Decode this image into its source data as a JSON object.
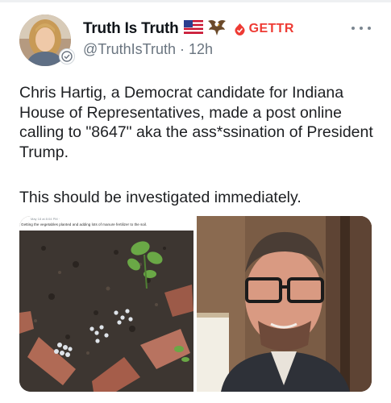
{
  "post": {
    "author": {
      "display_name": "Truth Is Truth",
      "handle": "@TruthIsTruth",
      "separator": "·",
      "time_ago": "12h",
      "badge_label": "GETTR"
    },
    "text_lines": [
      "Chris Hartig, a Democrat candidate for Indiana",
      "House of Representatives, made a post online",
      "calling to \"8647\" aka the ass*ssination of President",
      "Trump."
    ],
    "text_followup": "This should be investigated immediately.",
    "media": {
      "screenshot_meta": "May 18 at 8:04 PM · ",
      "screenshot_caption": "Getting the vegetables planted and adding lots of manure fertilizer to the soil."
    }
  },
  "colors": {
    "gettr_red": "#ee3b34",
    "handle_gray": "#6a7580",
    "text": "#1d1f22"
  },
  "icons": [
    "avatar",
    "verified-icon",
    "us-flag-icon",
    "eagle-icon",
    "gettr-logo-icon",
    "more-options-icon"
  ]
}
